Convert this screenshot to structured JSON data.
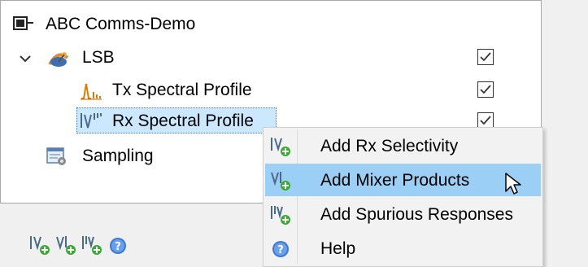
{
  "tree": {
    "root": {
      "label": "ABC Comms-Demo",
      "icon": "system-icon"
    },
    "lsb": {
      "label": "LSB",
      "icon": "antenna-icon",
      "expand_icon": "chevron-down-icon",
      "checked": true
    },
    "tx": {
      "label": "Tx Spectral Profile",
      "icon": "tx-spectrum-icon",
      "checked": true
    },
    "rx": {
      "label": "Rx Spectral Profile",
      "icon": "rx-spectrum-icon",
      "checked": true,
      "selected": true
    },
    "sampling": {
      "label": "Sampling",
      "icon": "sampling-icon"
    }
  },
  "toolbar": {
    "buttons": [
      {
        "name": "add-rx-selectivity-icon"
      },
      {
        "name": "add-mixer-products-icon"
      },
      {
        "name": "add-spurious-responses-icon"
      },
      {
        "name": "help-icon"
      }
    ]
  },
  "context_menu": {
    "items": [
      {
        "label": "Add Rx Selectivity",
        "icon": "add-rx-selectivity-icon"
      },
      {
        "label": "Add Mixer Products",
        "icon": "add-mixer-products-icon",
        "hovered": true
      },
      {
        "label": "Add Spurious Responses",
        "icon": "add-spurious-responses-icon"
      },
      {
        "label": "Help",
        "icon": "help-icon"
      }
    ]
  },
  "colors": {
    "selection": "#cce8ff",
    "menu_hover": "#9ccff5",
    "add_badge": "#3aa935",
    "tx_icon": "#e07b00",
    "help": "#3b78d8"
  }
}
